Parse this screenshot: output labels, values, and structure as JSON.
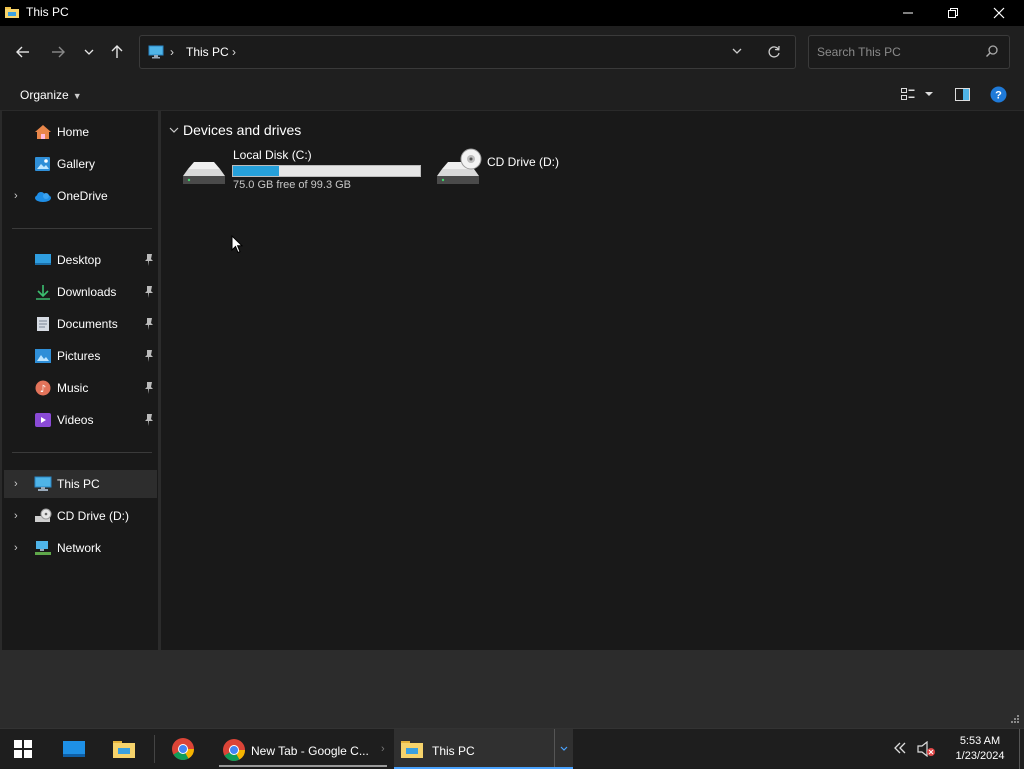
{
  "window": {
    "title": "This PC",
    "minimize_icon": "minimize-icon",
    "maximize_icon": "restore-icon",
    "close_icon": "close-icon"
  },
  "nav": {
    "back_icon": "arrow-left-icon",
    "forward_icon": "arrow-right-icon",
    "recent_icon": "chevron-down-icon",
    "up_icon": "arrow-up-icon"
  },
  "address": {
    "crumb": "This PC",
    "separator": "›"
  },
  "search": {
    "placeholder": "Search This PC"
  },
  "commandbar": {
    "organize_label": "Organize"
  },
  "sidebar": {
    "quick": [
      {
        "label": "Home",
        "icon": "home-icon",
        "expandable": false
      },
      {
        "label": "Gallery",
        "icon": "gallery-icon",
        "expandable": false
      },
      {
        "label": "OneDrive",
        "icon": "cloud-icon",
        "expandable": true
      }
    ],
    "pinned": [
      {
        "label": "Desktop",
        "icon": "desktop-icon"
      },
      {
        "label": "Downloads",
        "icon": "download-icon"
      },
      {
        "label": "Documents",
        "icon": "document-icon"
      },
      {
        "label": "Pictures",
        "icon": "picture-icon"
      },
      {
        "label": "Music",
        "icon": "music-icon"
      },
      {
        "label": "Videos",
        "icon": "video-icon"
      }
    ],
    "locations": [
      {
        "label": "This PC",
        "icon": "computer-icon",
        "selected": true
      },
      {
        "label": "CD Drive (D:)",
        "icon": "cd-drive-icon",
        "selected": false
      },
      {
        "label": "Network",
        "icon": "network-icon",
        "selected": false
      }
    ]
  },
  "content": {
    "group_title": "Devices and drives",
    "drives": [
      {
        "name": "Local Disk (C:)",
        "free_text": "75.0 GB free of 99.3 GB",
        "used_fraction": 0.245
      },
      {
        "name": "CD Drive (D:)"
      }
    ]
  },
  "taskbar": {
    "apps": [
      {
        "label": "New Tab - Google C...",
        "icon": "chrome-icon"
      },
      {
        "label": "This PC",
        "icon": "folder-icon",
        "active": true
      }
    ],
    "time": "5:53 AM",
    "date": "1/23/2024"
  },
  "colors": {
    "accent": "#26a0da",
    "window_bg": "#191919",
    "taskbar_bg": "#1e1e1e"
  }
}
